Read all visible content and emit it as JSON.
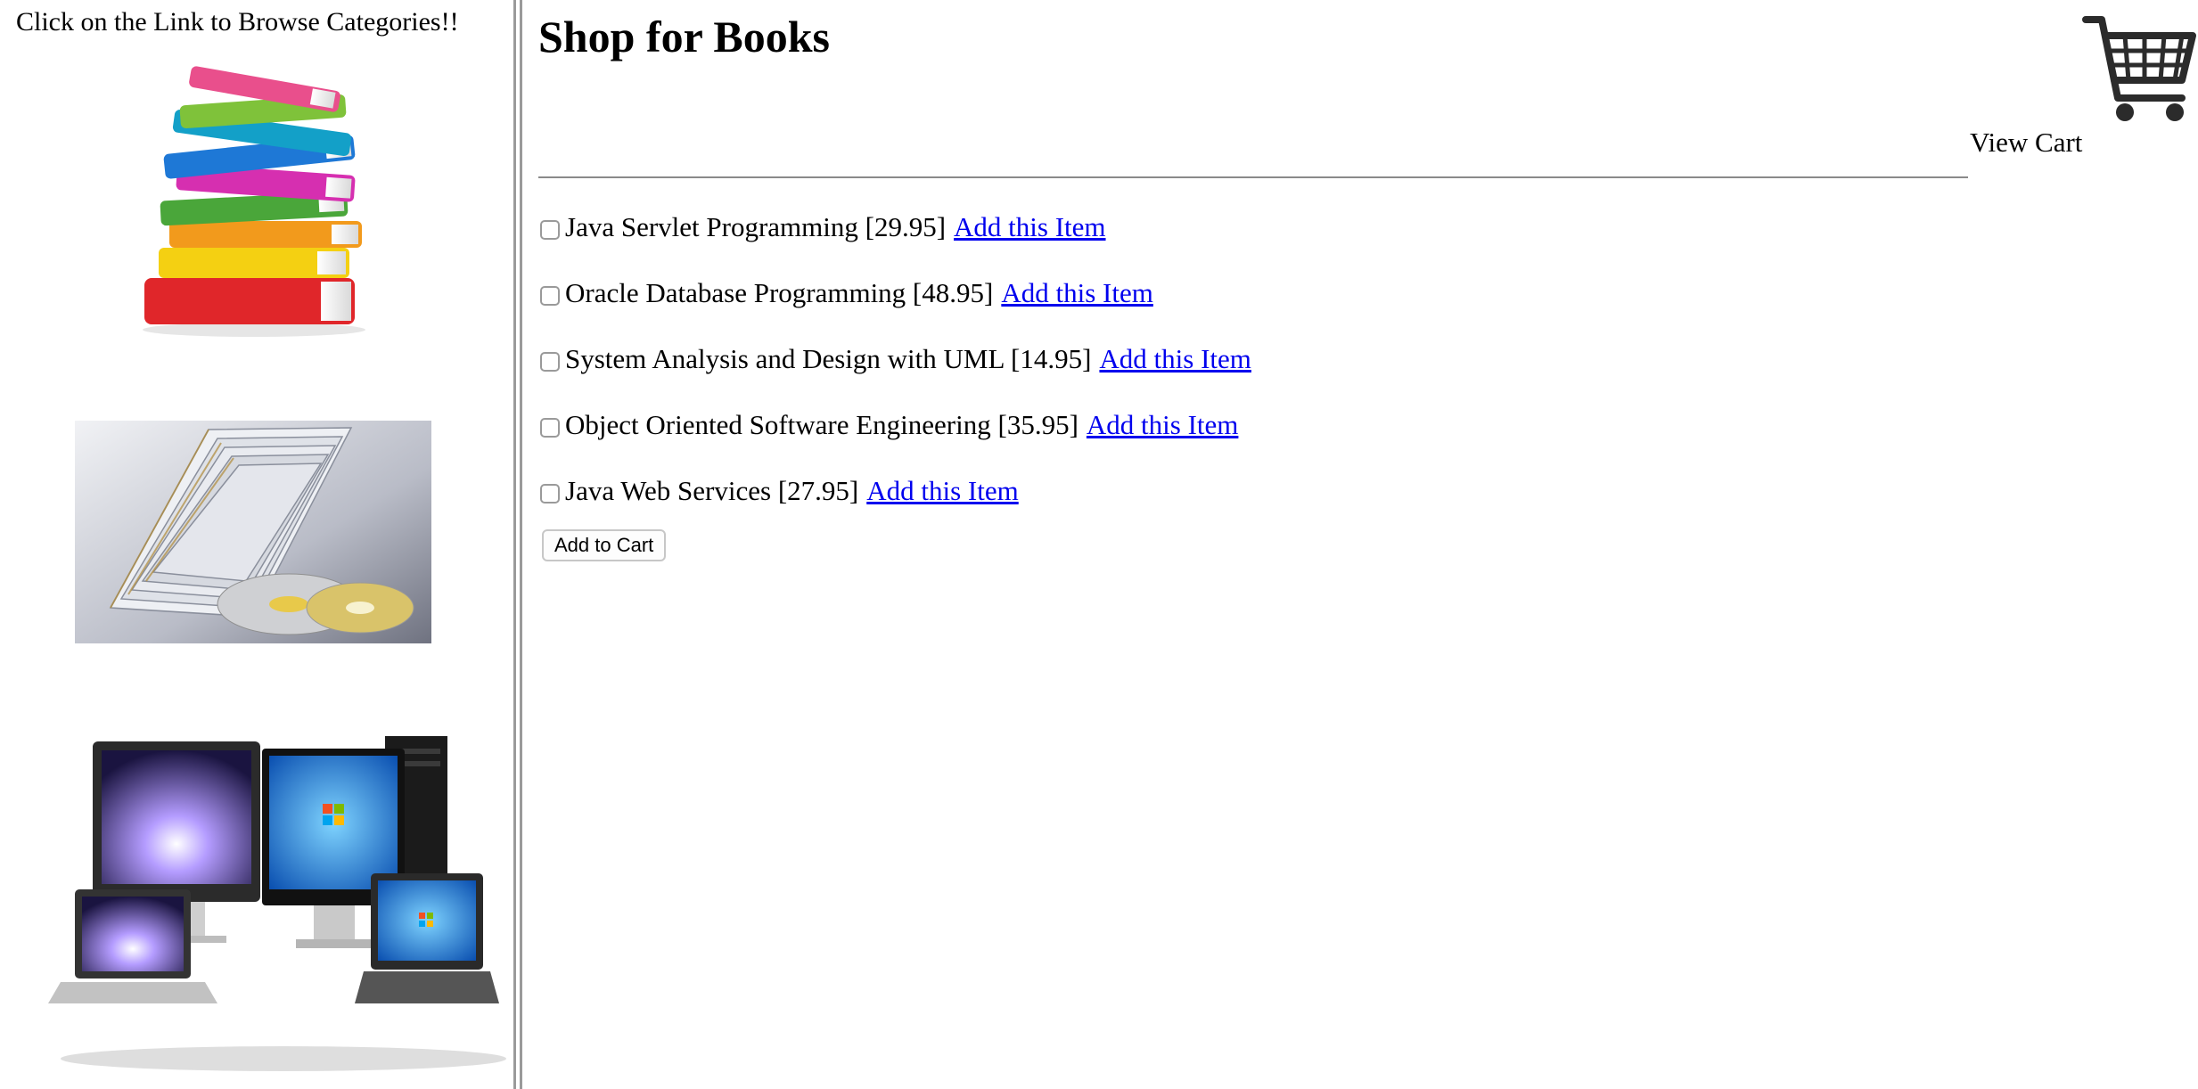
{
  "left_frame": {
    "heading": "Click on the Link to Browse Categories!!",
    "categories": [
      {
        "icon": "book-stack-image"
      },
      {
        "icon": "cd-stack-image"
      },
      {
        "icon": "computers-image"
      }
    ]
  },
  "main": {
    "title": "Shop for Books",
    "cart_icon": "shopping-cart-icon",
    "view_cart_label": "View Cart",
    "books": [
      {
        "label": "Java Servlet Programming [29.95]",
        "link": "Add this Item"
      },
      {
        "label": "Oracle Database Programming [48.95]",
        "link": "Add this Item"
      },
      {
        "label": "System Analysis and Design with UML [14.95]",
        "link": "Add this Item"
      },
      {
        "label": "Object Oriented Software Engineering [35.95]",
        "link": "Add this Item"
      },
      {
        "label": "Java Web Services [27.95]",
        "link": "Add this Item"
      }
    ],
    "add_to_cart_label": "Add to Cart"
  },
  "colors": {
    "link": "#0000ee",
    "divider": "#9a9a9a"
  }
}
